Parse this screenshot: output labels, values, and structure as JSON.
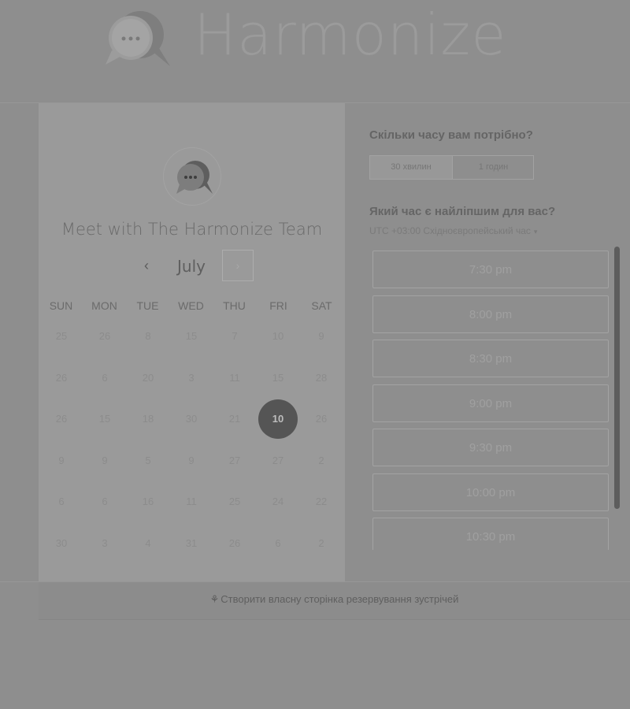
{
  "header": {
    "brand_name": "Harmonize",
    "logo_icon": "chat-bubbles-icon"
  },
  "calendar": {
    "avatar_icon": "chat-bubbles-icon",
    "title": "Meet with The Harmonize Team",
    "month": "July",
    "prev_icon": "chevron-left-icon",
    "next_icon": "chevron-right-icon",
    "prev_glyph": "‹",
    "next_glyph": "›",
    "weekdays": [
      "SUN",
      "MON",
      "TUE",
      "WED",
      "THU",
      "FRI",
      "SAT"
    ],
    "weeks": [
      [
        "25",
        "26",
        "8",
        "15",
        "7",
        "10",
        "9"
      ],
      [
        "26",
        "6",
        "20",
        "3",
        "11",
        "15",
        "28"
      ],
      [
        "26",
        "15",
        "18",
        "30",
        "21",
        "10",
        "26"
      ],
      [
        "9",
        "9",
        "5",
        "9",
        "27",
        "27",
        "2"
      ],
      [
        "6",
        "6",
        "16",
        "11",
        "25",
        "24",
        "22"
      ],
      [
        "30",
        "3",
        "4",
        "31",
        "26",
        "6",
        "2"
      ]
    ],
    "selected": {
      "week": 2,
      "day": 5,
      "label": "10"
    }
  },
  "booking": {
    "duration_question": "Скільки часу вам потрібно?",
    "durations": [
      "30 хвилин",
      "1 годин"
    ],
    "selected_duration": "30 хвилин",
    "time_question": "Який час є найліпшим для вас?",
    "timezone": "UTC +03:00 Східноєвропейський час",
    "timezone_caret": "▾",
    "slots": [
      "7:30 pm",
      "8:00 pm",
      "8:30 pm",
      "9:00 pm",
      "9:30 pm",
      "10:00 pm",
      "10:30 pm"
    ]
  },
  "footer": {
    "link_icon": "sprocket-icon",
    "link_glyph": "⚘",
    "link_text": "Створити власну сторінка резервування зустрічей"
  },
  "colors": {
    "overlay": "#8e8e8e",
    "selected_day": "#555555"
  }
}
